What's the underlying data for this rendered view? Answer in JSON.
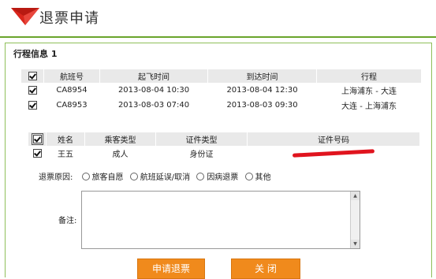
{
  "header": {
    "title": "退票申请"
  },
  "section": {
    "title": "行程信息 1"
  },
  "flights": {
    "headers": [
      "航班号",
      "起飞时间",
      "到达时间",
      "行程"
    ],
    "rows": [
      {
        "flight": "CA8954",
        "depart": "2013-08-04 10:30",
        "arrive": "2013-08-04 12:30",
        "route": "上海浦东 - 大连"
      },
      {
        "flight": "CA8953",
        "depart": "2013-08-03 07:40",
        "arrive": "2013-08-03 09:30",
        "route": "大连 - 上海浦东"
      }
    ]
  },
  "passengers": {
    "headers": [
      "姓名",
      "乘客类型",
      "证件类型",
      "证件号码"
    ],
    "rows": [
      {
        "name": "王五",
        "type": "成人",
        "id_type": "身份证"
      }
    ]
  },
  "refund": {
    "label": "退票原因:",
    "options": [
      "旅客自愿",
      "航班延误/取消",
      "因病退票",
      "其他"
    ]
  },
  "remark": {
    "label": "备注:"
  },
  "buttons": {
    "apply": "申请退票",
    "close": "关 闭"
  },
  "colors": {
    "accent_green": "#6aa52c",
    "button_orange": "#f08a1c",
    "logo_red": "#d9261c",
    "redaction": "#e0141e"
  }
}
